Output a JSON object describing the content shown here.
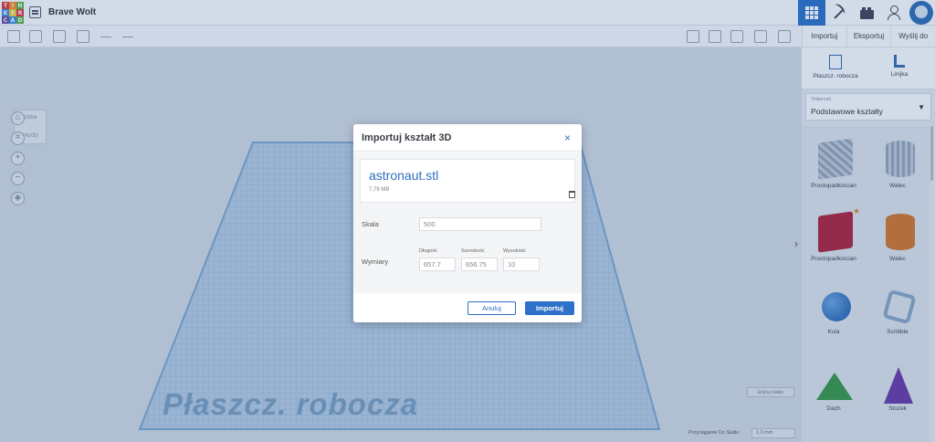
{
  "app": {
    "logo_letters": [
      "T",
      "I",
      "N",
      "K",
      "E",
      "R",
      "C",
      "A",
      "D"
    ],
    "project_title": "Brave Wolt"
  },
  "top_tabs": [
    "Importuj",
    "Eksportuj",
    "Wyślij do"
  ],
  "panel": {
    "workplane_label": "Płaszcz. robocza",
    "ruler_label": "Linijka",
    "library_caption": "Tinkercad",
    "library_value": "Podstawowe kształty",
    "shapes": [
      {
        "name": "Prostopadłościan"
      },
      {
        "name": "Walec"
      },
      {
        "name": "Prostopadłościan"
      },
      {
        "name": "Walec"
      },
      {
        "name": "Kula"
      },
      {
        "name": "Scribble"
      },
      {
        "name": "Dach"
      },
      {
        "name": "Stożek"
      }
    ]
  },
  "viewcube": {
    "top": "GÓRA",
    "front": "PRZÓD"
  },
  "workspace": {
    "plate_label": "Płaszcz. robocza",
    "edit_grid": "Edytuj siatkę",
    "snap_label": "Przyciąganie Do Siatki",
    "snap_value": "1,0 mm"
  },
  "dialog": {
    "title": "Importuj kształt 3D",
    "close": "×",
    "file_name": "astronaut.stl",
    "file_size": "7,79 MB",
    "scale_label": "Skala",
    "scale_value": "500",
    "dimensions_label": "Wymiary",
    "length_label": "Długość",
    "width_label": "Szerokość",
    "height_label": "Wysokość",
    "length_value": "657.7",
    "width_value": "656.75",
    "height_value": "10",
    "cancel": "Anuluj",
    "import": "Importuj"
  },
  "colors": {
    "accent": "#2d72c8",
    "overlay": "#1c4c8c"
  }
}
